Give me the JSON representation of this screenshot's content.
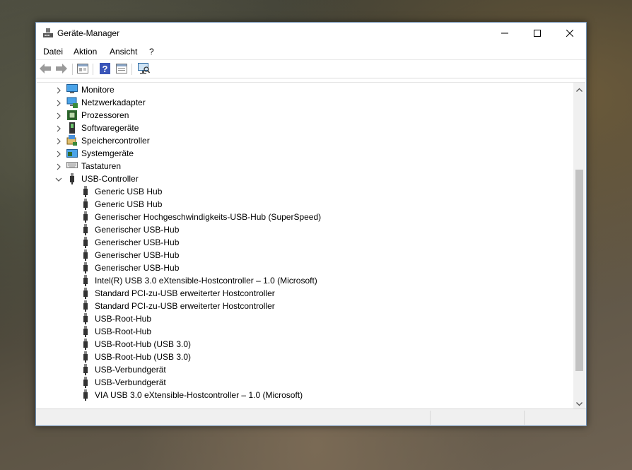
{
  "window": {
    "title": "Geräte-Manager"
  },
  "menu": {
    "items": [
      "Datei",
      "Aktion",
      "Ansicht",
      "?"
    ]
  },
  "toolbar": {
    "buttons": [
      "back-icon",
      "forward-icon",
      "properties-icon",
      "help-icon",
      "update-driver-icon",
      "scan-hardware-icon"
    ]
  },
  "tree": {
    "categories": [
      {
        "label": "Monitore",
        "icon": "monitor-icon",
        "expanded": false
      },
      {
        "label": "Netzwerkadapter",
        "icon": "network-adapter-icon",
        "expanded": false
      },
      {
        "label": "Prozessoren",
        "icon": "processor-icon",
        "expanded": false
      },
      {
        "label": "Softwaregeräte",
        "icon": "software-device-icon",
        "expanded": false
      },
      {
        "label": "Speichercontroller",
        "icon": "storage-controller-icon",
        "expanded": false
      },
      {
        "label": "Systemgeräte",
        "icon": "system-device-icon",
        "expanded": false
      },
      {
        "label": "Tastaturen",
        "icon": "keyboard-icon",
        "expanded": false
      },
      {
        "label": "USB-Controller",
        "icon": "usb-icon",
        "expanded": true
      }
    ],
    "usb_children": [
      "Generic USB Hub",
      "Generic USB Hub",
      "Generischer Hochgeschwindigkeits-USB-Hub (SuperSpeed)",
      "Generischer USB-Hub",
      "Generischer USB-Hub",
      "Generischer USB-Hub",
      "Generischer USB-Hub",
      "Intel(R) USB 3.0 eXtensible-Hostcontroller – 1.0 (Microsoft)",
      "Standard PCI-zu-USB erweiterter Hostcontroller",
      "Standard PCI-zu-USB erweiterter Hostcontroller",
      "USB-Root-Hub",
      "USB-Root-Hub",
      "USB-Root-Hub (USB 3.0)",
      "USB-Root-Hub (USB 3.0)",
      "USB-Verbundgerät",
      "USB-Verbundgerät",
      "VIA USB 3.0 eXtensible-Hostcontroller – 1.0 (Microsoft)"
    ]
  },
  "scroll": {
    "position": 0.45
  },
  "colors": {
    "accent": "#6f8fb3"
  }
}
